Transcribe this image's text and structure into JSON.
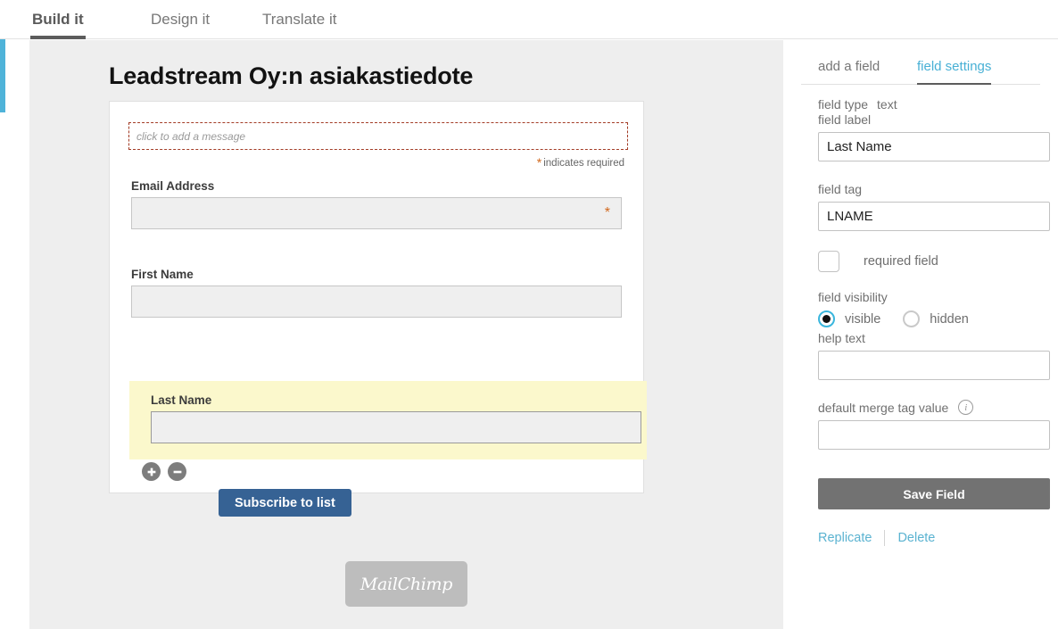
{
  "top_tabs": [
    {
      "label": "Build it",
      "active": true
    },
    {
      "label": "Design it",
      "active": false
    },
    {
      "label": "Translate it",
      "active": false
    }
  ],
  "form": {
    "title": "Leadstream Oy:n asiakastiedote",
    "message_placeholder": "click to add a message",
    "required_note": "indicates required",
    "required_star": "*",
    "fields": [
      {
        "label": "Email Address",
        "value": "",
        "required": true,
        "highlighted": false
      },
      {
        "label": "First Name",
        "value": "",
        "required": false,
        "highlighted": false
      },
      {
        "label": "Last Name",
        "value": "",
        "required": false,
        "highlighted": true
      }
    ],
    "add_field_icon": "plus-icon",
    "remove_field_icon": "minus-icon",
    "submit_label": "Subscribe to list",
    "footer_logo": "MailChimp"
  },
  "panel": {
    "tabs": [
      {
        "label": "add a field",
        "active": false
      },
      {
        "label": "field settings",
        "active": true
      }
    ],
    "field_type_label": "field type",
    "field_type_value": "text",
    "field_label_label": "field label",
    "field_label_value": "Last Name",
    "field_tag_label": "field tag",
    "field_tag_value": "LNAME",
    "required_field_label": "required field",
    "required_field_checked": false,
    "visibility_label": "field visibility",
    "visibility_options": [
      {
        "label": "visible",
        "selected": true
      },
      {
        "label": "hidden",
        "selected": false
      }
    ],
    "help_text_label": "help text",
    "help_text_value": "",
    "default_merge_label": "default merge tag value",
    "default_merge_value": "",
    "info_icon": "info-icon",
    "save_label": "Save Field",
    "replicate_label": "Replicate",
    "delete_label": "Delete"
  },
  "colors": {
    "accent_blue": "#4fb3d9",
    "panel_link": "#5bb3d1",
    "submit_blue": "#366294",
    "save_gray": "#727272",
    "highlight_yellow": "#fbf8cc",
    "required_orange": "#d2691e",
    "canvas_gray": "#eeeeee"
  }
}
